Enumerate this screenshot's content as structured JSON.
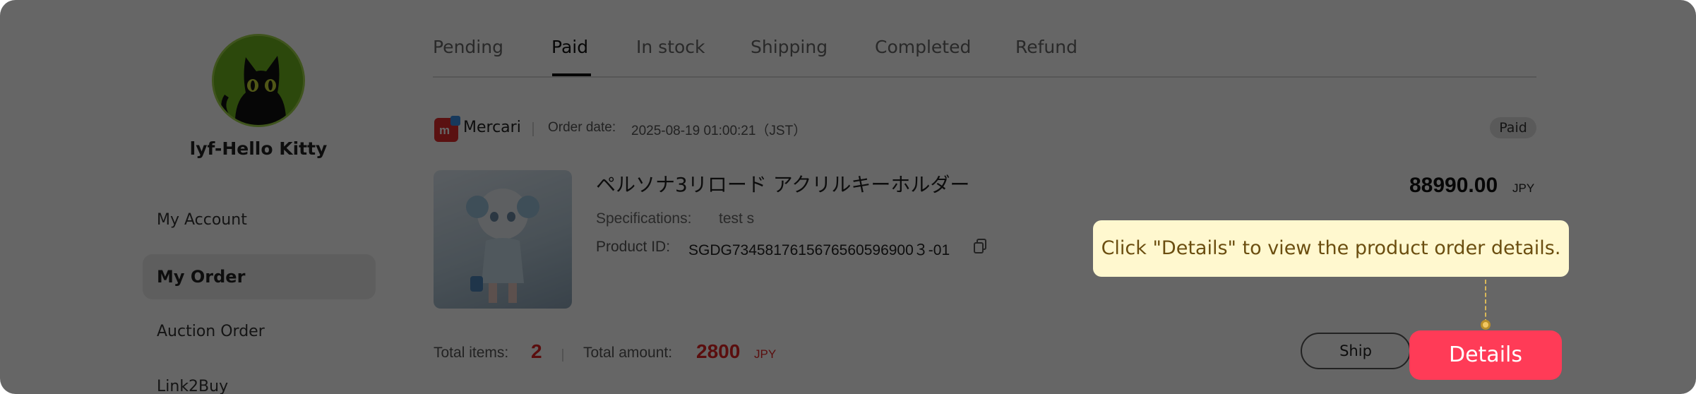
{
  "sidebar": {
    "username": "lyf-Hello Kitty",
    "items": [
      {
        "label": "My Account"
      },
      {
        "label": "My Order"
      },
      {
        "label": "Auction Order"
      },
      {
        "label": "Link2Buy"
      }
    ]
  },
  "tabs": [
    "Pending",
    "Paid",
    "In stock",
    "Shipping",
    "Completed",
    "Refund"
  ],
  "order": {
    "store_logo_text": "m",
    "store_name": "Mercari",
    "order_date_label": "Order date:",
    "order_date_value": "2025-08-19 01:00:21（JST）",
    "status": "Paid",
    "product_title": "ペルソナ3リロード アクリルキーホルダー",
    "spec_label": "Specifications:",
    "spec_value": "test s",
    "product_id_label": "Product ID:",
    "product_id_value": "SGDG7345817615676560596900３-01",
    "price": "88990.00",
    "price_currency": "JPY",
    "total_items_label": "Total items:",
    "total_items_value": "2",
    "total_amount_label": "Total amount:",
    "total_amount_value": "2800",
    "total_amount_currency": "JPY",
    "ship_label": "Ship",
    "details_label": "Details"
  },
  "guide": {
    "tooltip": "Click \"Details\" to view the product order details."
  },
  "colors": {
    "accent": "#ff3b57",
    "price_red": "#e02424",
    "tooltip_bg": "#fff8cf",
    "overlay": "rgba(0,0,0,0.60)"
  }
}
